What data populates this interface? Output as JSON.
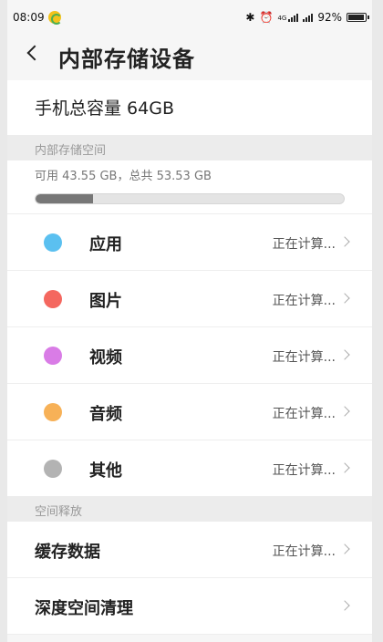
{
  "status_bar": {
    "time": "08:09",
    "battery": "92%"
  },
  "header": {
    "title": "内部存储设备"
  },
  "capacity": {
    "label": "手机总容量 64GB"
  },
  "storage_section": {
    "header": "内部存储空间",
    "summary": "可用 43.55 GB，总共 53.53 GB",
    "used_fraction": 0.187
  },
  "categories": [
    {
      "label": "应用",
      "status": "正在计算...",
      "color": "#5bc0f0"
    },
    {
      "label": "图片",
      "status": "正在计算...",
      "color": "#f4675f"
    },
    {
      "label": "视频",
      "status": "正在计算...",
      "color": "#d97ce6"
    },
    {
      "label": "音频",
      "status": "正在计算...",
      "color": "#f7b157"
    },
    {
      "label": "其他",
      "status": "正在计算...",
      "color": "#b3b3b3"
    }
  ],
  "release_section": {
    "header": "空间释放",
    "items": [
      {
        "label": "缓存数据",
        "status": "正在计算..."
      },
      {
        "label": "深度空间清理",
        "status": ""
      }
    ]
  }
}
